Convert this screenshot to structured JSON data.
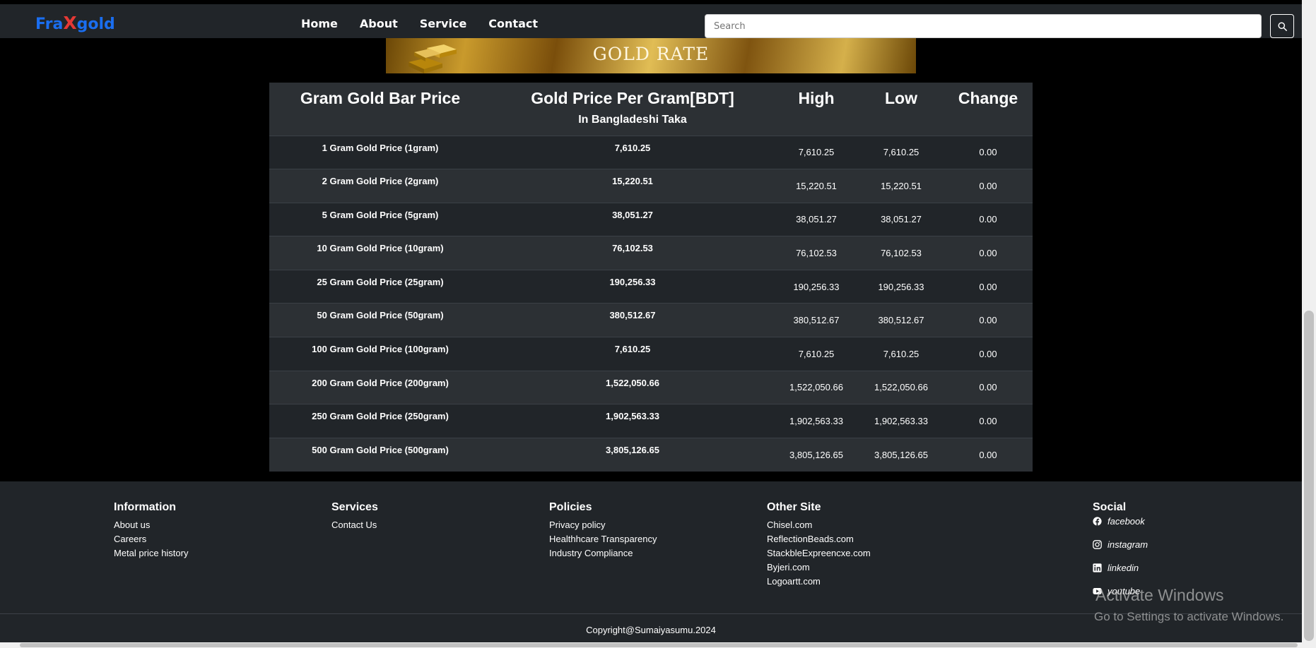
{
  "nav": {
    "brand_prefix": "Fra",
    "brand_x": "X",
    "brand_suffix": "gold",
    "links": [
      "Home",
      "About",
      "Service",
      "Contact"
    ],
    "search_placeholder": "Search"
  },
  "banner": {
    "title": "GOLD RATE"
  },
  "table": {
    "headers": {
      "col1": "Gram Gold Bar Price",
      "col2": "Gold Price Per Gram[BDT]",
      "col2_sub": "In Bangladeshi Taka",
      "col3": "High",
      "col4": "Low",
      "col5": "Change"
    },
    "rows": [
      {
        "name": "1 Gram Gold Price (1gram)",
        "price": "7,610.25",
        "high": "7,610.25",
        "low": "7,610.25",
        "change": "0.00"
      },
      {
        "name": "2 Gram Gold Price (2gram)",
        "price": "15,220.51",
        "high": "15,220.51",
        "low": "15,220.51",
        "change": "0.00"
      },
      {
        "name": "5 Gram Gold Price (5gram)",
        "price": "38,051.27",
        "high": "38,051.27",
        "low": "38,051.27",
        "change": "0.00"
      },
      {
        "name": "10 Gram Gold Price (10gram)",
        "price": "76,102.53",
        "high": "76,102.53",
        "low": "76,102.53",
        "change": "0.00"
      },
      {
        "name": "25 Gram Gold Price (25gram)",
        "price": "190,256.33",
        "high": "190,256.33",
        "low": "190,256.33",
        "change": "0.00"
      },
      {
        "name": "50 Gram Gold Price (50gram)",
        "price": "380,512.67",
        "high": "380,512.67",
        "low": "380,512.67",
        "change": "0.00"
      },
      {
        "name": "100 Gram Gold Price (100gram)",
        "price": "7,610.25",
        "high": "7,610.25",
        "low": "7,610.25",
        "change": "0.00"
      },
      {
        "name": "200 Gram Gold Price (200gram)",
        "price": "1,522,050.66",
        "high": "1,522,050.66",
        "low": "1,522,050.66",
        "change": "0.00"
      },
      {
        "name": "250 Gram Gold Price (250gram)",
        "price": "1,902,563.33",
        "high": "1,902,563.33",
        "low": "1,902,563.33",
        "change": "0.00"
      },
      {
        "name": "500 Gram Gold Price (500gram)",
        "price": "3,805,126.65",
        "high": "3,805,126.65",
        "low": "3,805,126.65",
        "change": "0.00"
      }
    ]
  },
  "footer": {
    "information": {
      "title": "Information",
      "links": [
        "About us",
        "Careers",
        "Metal price history"
      ]
    },
    "services": {
      "title": "Services",
      "links": [
        "Contact Us"
      ]
    },
    "policies": {
      "title": "Policies",
      "links": [
        "Privacy policy",
        "Healthhcare Transparency",
        "Industry Compliance"
      ]
    },
    "other_site": {
      "title": "Other Site",
      "links": [
        "Chisel.com",
        "ReflectionBeads.com",
        "StackbleExpreencxe.com",
        "Byjeri.com",
        "Logoartt.com"
      ]
    },
    "social": {
      "title": "Social",
      "links": [
        "facebook",
        "instagram",
        "linkedin",
        "youtube"
      ]
    },
    "copyright": "Copyright@Sumaiyasumu.2024"
  },
  "watermark": {
    "title": "Activate Windows",
    "subtitle": "Go to Settings to activate Windows."
  },
  "colors": {
    "brand_blue": "#1a6ef0",
    "brand_red": "#e53935",
    "change_red": "#e53945",
    "footer_bg": "#212529"
  }
}
